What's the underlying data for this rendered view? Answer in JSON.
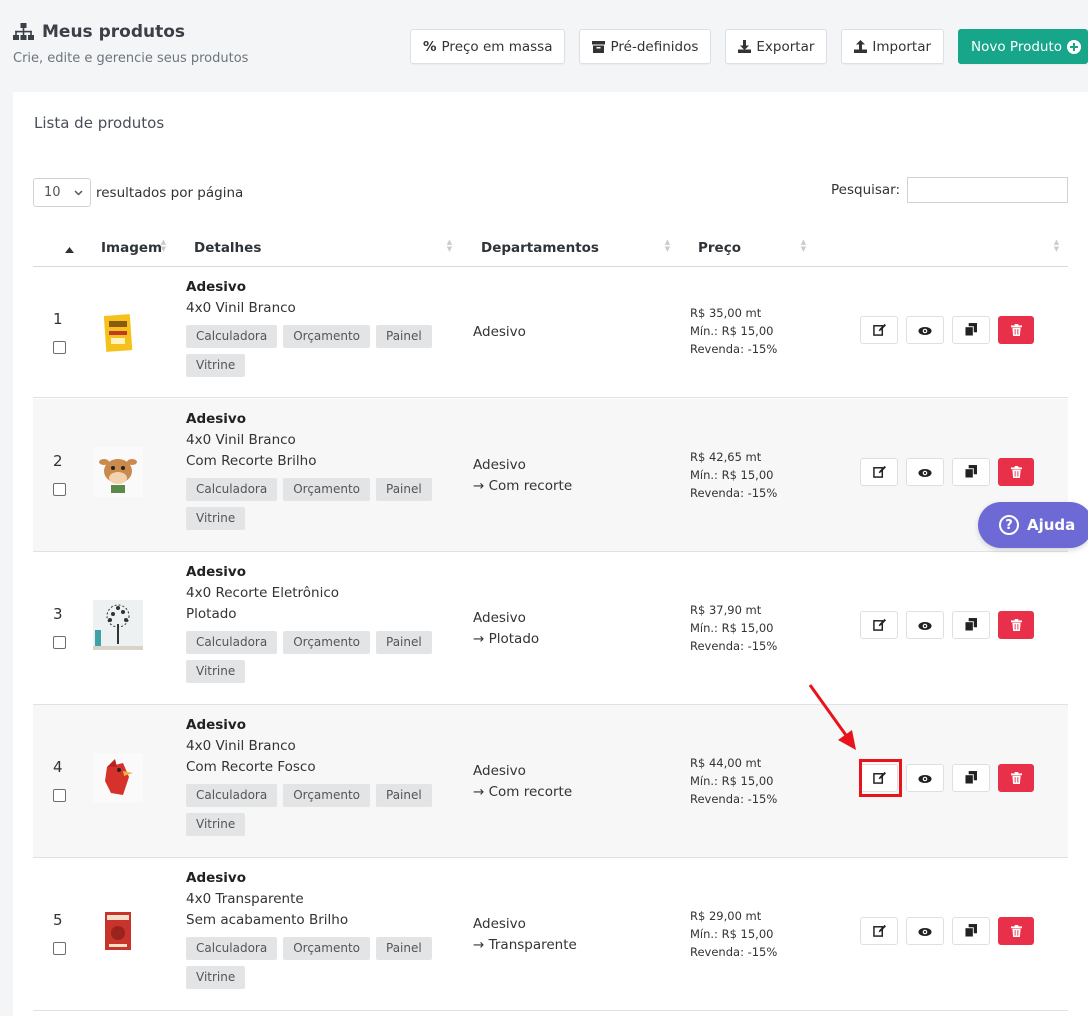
{
  "header": {
    "title": "Meus produtos",
    "subtitle": "Crie, edite e gerencie seus produtos"
  },
  "toolbar": {
    "mass_price": "Preço em massa",
    "predefined": "Pré-definidos",
    "export": "Exportar",
    "import": "Importar",
    "new_product": "Novo Produto"
  },
  "card": {
    "title": "Lista de produtos",
    "page_length": "10",
    "page_length_suffix": "resultados por página",
    "search_label": "Pesquisar:",
    "search_value": ""
  },
  "columns": {
    "image": "Imagem",
    "details": "Detalhes",
    "departments": "Departamentos",
    "price": "Preço"
  },
  "rows": [
    {
      "num": "1",
      "title": "Adesivo",
      "line1": "4x0 Vinil Branco",
      "line2": "",
      "dept1": "Adesivo",
      "dept2": "",
      "price": "R$ 35,00 mt",
      "min": "Mín.: R$ 15,00",
      "resale": "Revenda: -15%",
      "thumb": "yellow-food-sticker"
    },
    {
      "num": "2",
      "title": "Adesivo",
      "line1": "4x0 Vinil Branco",
      "line2": "Com Recorte Brilho",
      "dept1": "Adesivo",
      "dept2": "→ Com recorte",
      "price": "R$ 42,65 mt",
      "min": "Mín.: R$ 15,00",
      "resale": "Revenda: -15%",
      "thumb": "cow-sticker"
    },
    {
      "num": "3",
      "title": "Adesivo",
      "line1": "4x0 Recorte Eletrônico",
      "line2": "Plotado",
      "dept1": "Adesivo",
      "dept2": "→ Plotado",
      "price": "R$ 37,90 mt",
      "min": "Mín.: R$ 15,00",
      "resale": "Revenda: -15%",
      "thumb": "tree-wall-decal"
    },
    {
      "num": "4",
      "title": "Adesivo",
      "line1": "4x0 Vinil Branco",
      "line2": "Com Recorte Fosco",
      "dept1": "Adesivo",
      "dept2": "→ Com recorte",
      "price": "R$ 44,00 mt",
      "min": "Mín.: R$ 15,00",
      "resale": "Revenda: -15%",
      "thumb": "red-bird-sticker"
    },
    {
      "num": "5",
      "title": "Adesivo",
      "line1": "4x0 Transparente",
      "line2": "Sem acabamento Brilho",
      "dept1": "Adesivo",
      "dept2": "→ Transparente",
      "price": "R$ 29,00 mt",
      "min": "Mín.: R$ 15,00",
      "resale": "Revenda: -15%",
      "thumb": "dinner-poster"
    }
  ],
  "tags": [
    "Calculadora",
    "Orçamento",
    "Painel",
    "Vitrine"
  ],
  "help": {
    "label": "Ajuda"
  },
  "colors": {
    "primary": "#17a689",
    "danger": "#e8304a",
    "help": "#6d6ad6",
    "highlight": "#e8141b"
  }
}
